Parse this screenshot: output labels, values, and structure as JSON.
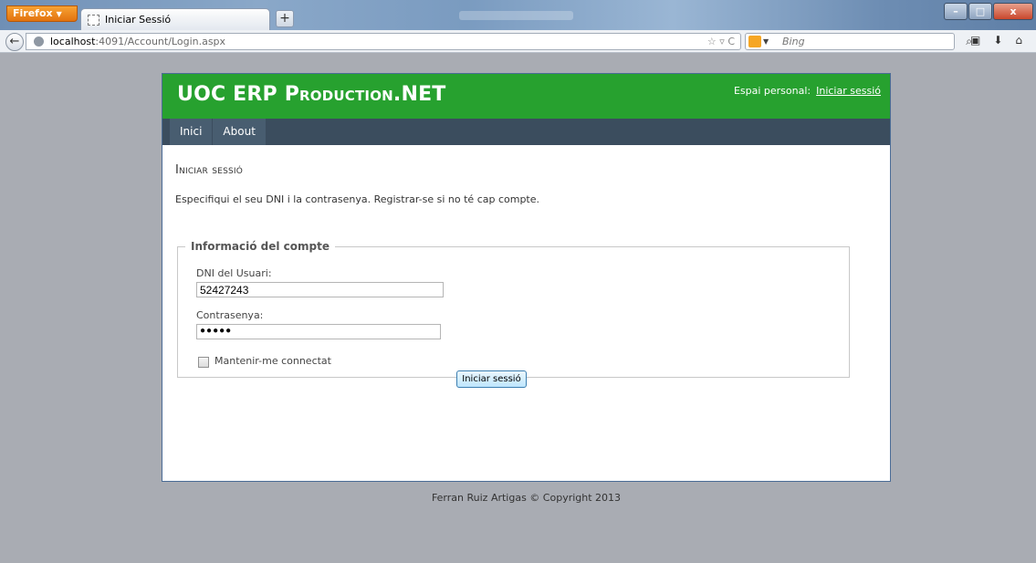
{
  "browser": {
    "app_button_label": "Firefox",
    "tab_title": "Iniciar Sessió",
    "new_tab_label": "+",
    "url_host": "localhost",
    "url_path": ":4091/Account/Login.aspx",
    "search_placeholder": "Bing",
    "window_buttons": {
      "minimize": "–",
      "maximize": "□",
      "close": "x"
    }
  },
  "site": {
    "title": "UOC ERP Production.NET",
    "login_prefix": "Espai personal:",
    "login_link": "Iniciar sessió",
    "menu": [
      {
        "label": "Inici"
      },
      {
        "label": "About"
      }
    ]
  },
  "login": {
    "heading": "Iniciar sessió",
    "intro": "Especifiqui el seu DNI i la contrasenya. Registrar-se si no té cap compte.",
    "legend": "Informació del compte",
    "username_label": "DNI del Usuari:",
    "username_value": "52427243",
    "password_label": "Contrasenya:",
    "password_mask": "●●●●●",
    "remember_label": "Mantenir-me connectat",
    "submit_label": "Iniciar sessió"
  },
  "footer": {
    "text": "Ferran Ruiz Artigas © Copyright 2013"
  },
  "colors": {
    "header_green": "#27a12f",
    "menu_bg": "#3b4d5e",
    "page_bg": "#a9acb3"
  }
}
